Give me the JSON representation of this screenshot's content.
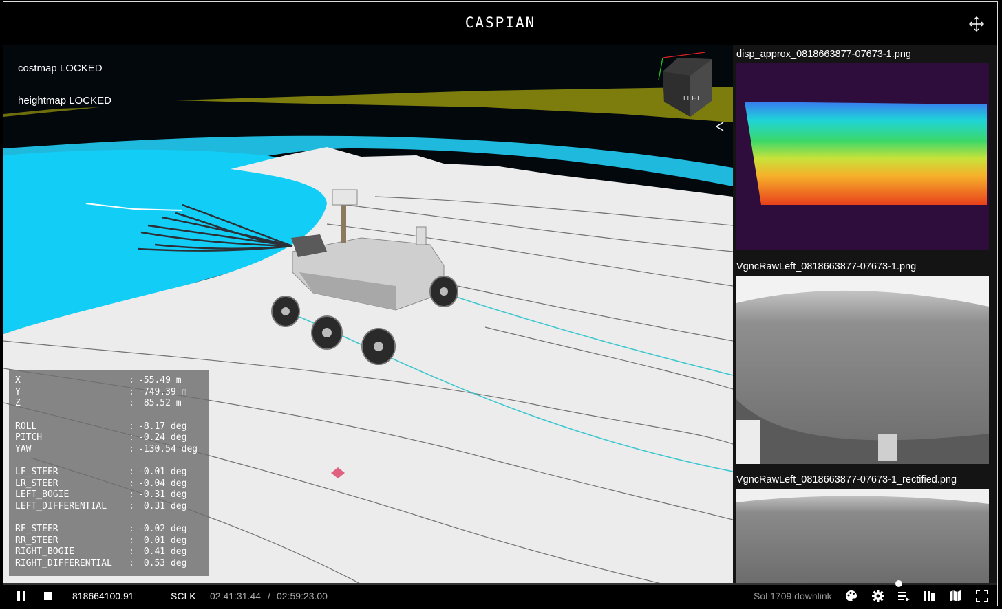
{
  "app": {
    "title": "CASPIAN"
  },
  "overlay": {
    "costmap_label": "costmap LOCKED",
    "heightmap_label": "heightmap LOCKED",
    "view_cube_face": "LEFT"
  },
  "telemetry": [
    {
      "key": "X",
      "value": "-55.49 m"
    },
    {
      "key": "Y",
      "value": "-749.39 m"
    },
    {
      "key": "Z",
      "value": " 85.52 m"
    },
    {
      "key": "ROLL",
      "value": "-8.17 deg"
    },
    {
      "key": "PITCH",
      "value": "-0.24 deg"
    },
    {
      "key": "YAW",
      "value": "-130.54 deg"
    },
    {
      "key": "LF_STEER",
      "value": "-0.01 deg"
    },
    {
      "key": "LR_STEER",
      "value": "-0.04 deg"
    },
    {
      "key": "LEFT_BOGIE",
      "value": "-0.31 deg"
    },
    {
      "key": "LEFT_DIFFERENTIAL",
      "value": " 0.31 deg"
    },
    {
      "key": "RF_STEER",
      "value": "-0.02 deg"
    },
    {
      "key": "RR_STEER",
      "value": " 0.01 deg"
    },
    {
      "key": "RIGHT_BOGIE",
      "value": " 0.41 deg"
    },
    {
      "key": "RIGHT_DIFFERENTIAL",
      "value": " 0.53 deg"
    }
  ],
  "sidebar": {
    "images": [
      {
        "title": "disp_approx_0818663877-07673-1.png"
      },
      {
        "title": "VgncRawLeft_0818663877-07673-1.png"
      },
      {
        "title": "VgncRawLeft_0818663877-07673-1_rectified.png"
      }
    ]
  },
  "playback": {
    "sclk_value": "818664100.91",
    "sclk_label": "SCLK",
    "current_time": "02:41:31.44",
    "separator": "/",
    "total_time": "02:59:23.00",
    "downlink_label": "Sol 1709 downlink",
    "progress": 0.9
  },
  "icons": [
    "move-icon",
    "pause-icon",
    "stop-icon",
    "palette-icon",
    "gear-icon",
    "playlist-icon",
    "library-icon",
    "map-icon",
    "fullscreen-icon"
  ],
  "colors": {
    "costmap": "#16c8f0",
    "heightmap": "#8a8a10",
    "terrain": "#e8e8e8",
    "trajectory": "#3ec7cf"
  }
}
